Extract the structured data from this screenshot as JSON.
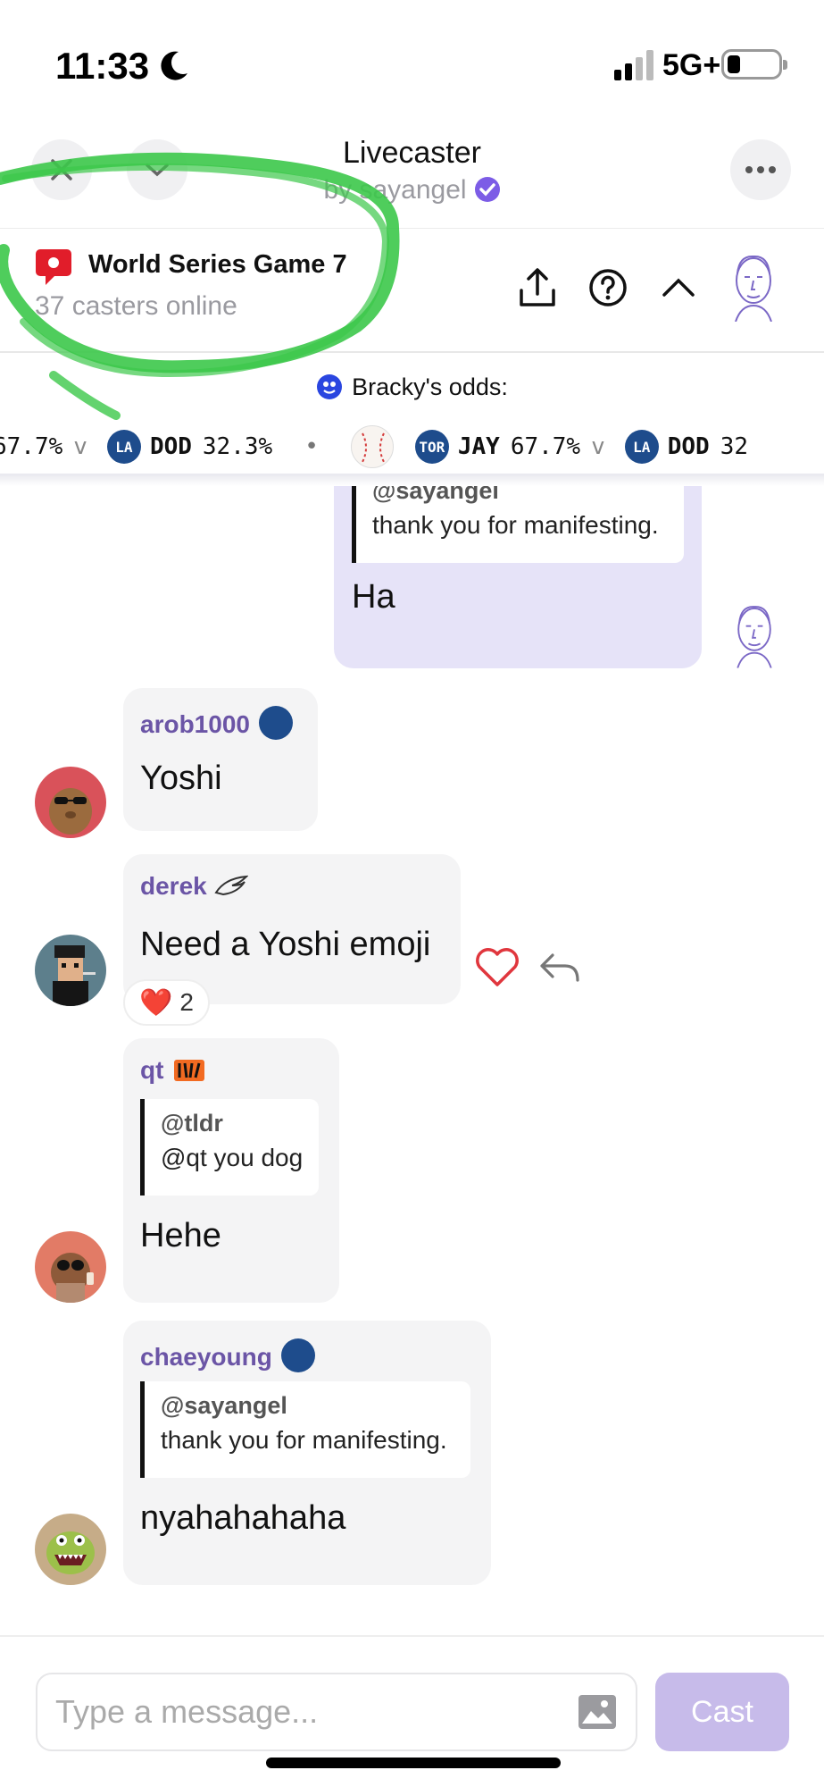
{
  "status_bar": {
    "time": "11:33",
    "network": "5G+"
  },
  "header": {
    "title": "Livecaster",
    "byline": "by sayangel"
  },
  "game": {
    "title": "World Series Game 7",
    "subtitle": "37 casters online"
  },
  "odds": {
    "label": "Bracky's odds:",
    "left_pct": "67.7%",
    "v1": "v",
    "team_b": "DOD",
    "team_b_pct": "32.3%",
    "dot": "•",
    "team_a": "JAY",
    "team_a_pct": "67.7%",
    "v2": "v",
    "team_b2": "DOD",
    "team_b2_pct": "32"
  },
  "messages": [
    {
      "quote_user": "@sayangel",
      "quote_text": "thank you for manifesting.",
      "text": "Ha"
    },
    {
      "user": "arob1000",
      "text": "Yoshi"
    },
    {
      "user": "derek",
      "text": "Need a Yoshi emoji",
      "reaction_emoji": "❤️",
      "reaction_count": "2"
    },
    {
      "user": "qt",
      "quote_user": "@tldr",
      "quote_text": "@qt you dog",
      "text": "Hehe"
    },
    {
      "user": "chaeyoung",
      "quote_user": "@sayangel",
      "quote_text": "thank you for manifesting.",
      "text": "nyahahahaha"
    }
  ],
  "composer": {
    "placeholder": "Type a message...",
    "cast_label": "Cast"
  },
  "colors": {
    "accent": "#6b55a6",
    "my_bubble": "#e6e3f8",
    "bubble": "#f4f4f5",
    "cast_button": "#c7bbea",
    "marker": "#3cc84a"
  },
  "icons": [
    "moon-icon",
    "signal-icon",
    "battery-icon",
    "close-icon",
    "chevron-down-icon",
    "more-icon",
    "verified-icon",
    "live-icon",
    "share-icon",
    "help-icon",
    "chevron-up-icon",
    "heart-icon",
    "reply-icon",
    "image-icon"
  ]
}
